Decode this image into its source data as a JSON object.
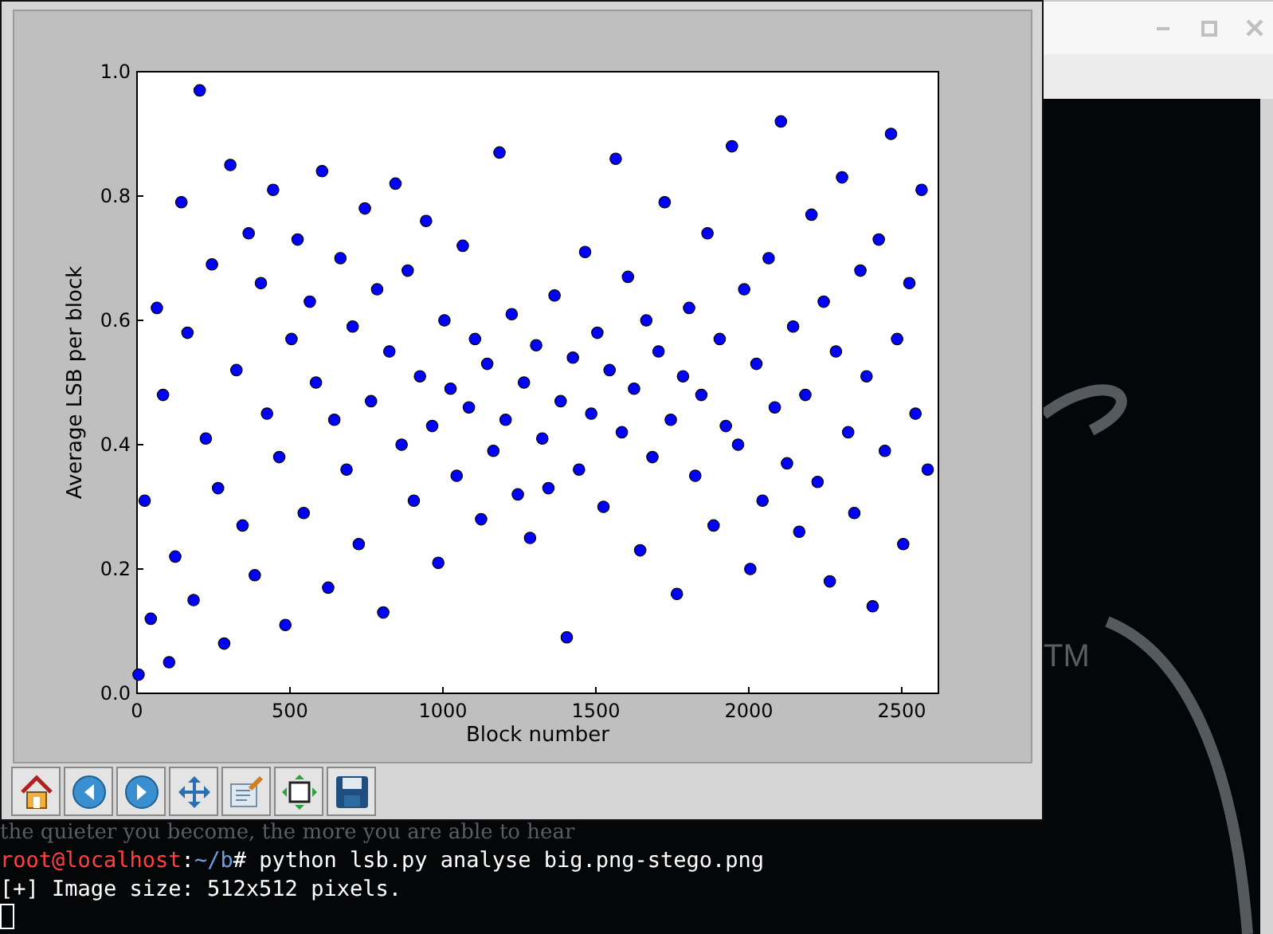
{
  "wallpaper": {
    "slogan": "the quieter you become, the more you are able to hear",
    "trademark": "TM"
  },
  "terminal": {
    "prompt": {
      "user": "root@localhost",
      "separator": ":",
      "path": "~/b",
      "command": "# python lsb.py analyse big.png-stego.png"
    },
    "output": [
      "[+] Image size: 512x512 pixels."
    ]
  },
  "plot_window": {
    "chart_data": {
      "type": "scatter",
      "xlabel": "Block number",
      "ylabel": "Average LSB per block",
      "xlim": [
        0,
        2620
      ],
      "ylim": [
        0,
        1
      ],
      "xticks": [
        0,
        500,
        1000,
        1500,
        2000,
        2500
      ],
      "yticks": [
        {
          "value": 0,
          "label": "0.0"
        },
        {
          "value": 0.2,
          "label": "0.2"
        },
        {
          "value": 0.4,
          "label": "0.4"
        },
        {
          "value": 0.6,
          "label": "0.6"
        },
        {
          "value": 0.8,
          "label": "0.8"
        },
        {
          "value": 1,
          "label": "1.0"
        }
      ],
      "x": [
        5,
        25,
        45,
        65,
        85,
        105,
        125,
        145,
        165,
        185,
        205,
        225,
        245,
        265,
        285,
        305,
        325,
        345,
        365,
        385,
        405,
        425,
        445,
        465,
        485,
        505,
        525,
        545,
        565,
        585,
        605,
        625,
        645,
        665,
        685,
        705,
        725,
        745,
        765,
        785,
        805,
        825,
        845,
        865,
        885,
        905,
        925,
        945,
        965,
        985,
        1005,
        1025,
        1045,
        1065,
        1085,
        1105,
        1125,
        1145,
        1165,
        1185,
        1205,
        1225,
        1245,
        1265,
        1285,
        1305,
        1325,
        1345,
        1365,
        1385,
        1405,
        1425,
        1445,
        1465,
        1485,
        1505,
        1525,
        1545,
        1565,
        1585,
        1605,
        1625,
        1645,
        1665,
        1685,
        1705,
        1725,
        1745,
        1765,
        1785,
        1805,
        1825,
        1845,
        1865,
        1885,
        1905,
        1925,
        1945,
        1965,
        1985,
        2005,
        2025,
        2045,
        2065,
        2085,
        2105,
        2125,
        2145,
        2165,
        2185,
        2205,
        2225,
        2245,
        2265,
        2285,
        2305,
        2325,
        2345,
        2365,
        2385,
        2405,
        2425,
        2445,
        2465,
        2485,
        2505,
        2525,
        2545,
        2565,
        2585
      ],
      "series": [
        {
          "color": "#0000ff",
          "values": [
            0.03,
            0.31,
            0.12,
            0.62,
            0.48,
            0.05,
            0.22,
            0.79,
            0.58,
            0.15,
            0.97,
            0.41,
            0.69,
            0.33,
            0.08,
            0.85,
            0.52,
            0.27,
            0.74,
            0.19,
            0.66,
            0.45,
            0.81,
            0.38,
            0.11,
            0.57,
            0.73,
            0.29,
            0.63,
            0.5,
            0.84,
            0.17,
            0.44,
            0.7,
            0.36,
            0.59,
            0.24,
            0.78,
            0.47,
            0.65,
            0.13,
            0.55,
            0.82,
            0.4,
            0.68,
            0.31,
            0.51,
            0.76,
            0.43,
            0.21,
            0.6,
            0.49,
            0.35,
            0.72,
            0.46,
            0.57,
            0.28,
            0.53,
            0.39,
            0.87,
            0.44,
            0.61,
            0.32,
            0.5,
            0.25,
            0.56,
            0.41,
            0.33,
            0.64,
            0.47,
            0.09,
            0.54,
            0.36,
            0.71,
            0.45,
            0.58,
            0.3,
            0.52,
            0.86,
            0.42,
            0.67,
            0.49,
            0.23,
            0.6,
            0.38,
            0.55,
            0.79,
            0.44,
            0.16,
            0.51,
            0.62,
            0.35,
            0.48,
            0.74,
            0.27,
            0.57,
            0.43,
            0.88,
            0.4,
            0.65,
            0.2,
            0.53,
            0.31,
            0.7,
            0.46,
            0.92,
            0.37,
            0.59,
            0.26,
            0.48,
            0.77,
            0.34,
            0.63,
            0.18,
            0.55,
            0.83,
            0.42,
            0.29,
            0.68,
            0.51,
            0.14,
            0.73,
            0.39,
            0.9,
            0.57,
            0.24,
            0.66,
            0.45,
            0.81,
            0.36
          ]
        }
      ]
    }
  }
}
